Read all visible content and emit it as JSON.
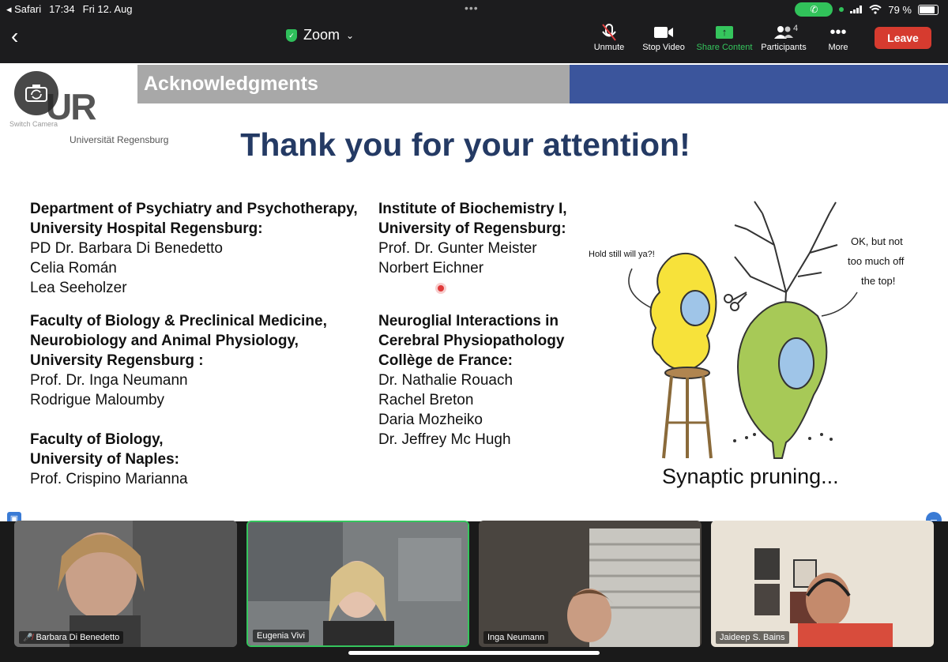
{
  "status": {
    "app": "Safari",
    "time": "17:34",
    "date": "Fri 12. Aug",
    "battery": "79 %",
    "battery_level": 0.79
  },
  "toolbar": {
    "title": "Zoom",
    "buttons": [
      {
        "label": "Unmute",
        "icon": "microphone-off-icon"
      },
      {
        "label": "Stop Video",
        "icon": "video-camera-icon"
      },
      {
        "label": "Share Content",
        "icon": "share-screen-icon"
      },
      {
        "label": "Participants",
        "icon": "participants-icon",
        "count": "4"
      },
      {
        "label": "More",
        "icon": "more-dots-icon"
      }
    ],
    "leave": "Leave",
    "accent": "#35c55d",
    "leave_color": "#d63b2f"
  },
  "slide": {
    "header": "Acknowledgments",
    "logo_letters": "UR",
    "logo_text": "Universität Regensburg",
    "switch_camera": "Switch Camera",
    "title": "Thank you for your attention!",
    "left_col": [
      {
        "heading": [
          "Department of Psychiatry and Psychotherapy,",
          "University Hospital Regensburg:"
        ],
        "names": [
          "PD Dr. Barbara Di Benedetto",
          "Celia Román",
          "Lea Seeholzer"
        ]
      },
      {
        "heading": [
          "Faculty of Biology & Preclinical Medicine,",
          "Neurobiology and Animal Physiology,",
          "University Regensburg :"
        ],
        "names": [
          "Prof. Dr. Inga Neumann",
          "Rodrigue Maloumby"
        ]
      },
      {
        "heading": [
          "Faculty of Biology,",
          "University of Naples:"
        ],
        "names": [
          "Prof. Crispino Marianna"
        ]
      }
    ],
    "right_col": [
      {
        "heading": [
          "Institute of Biochemistry I,",
          "University of Regensburg:"
        ],
        "names": [
          "Prof. Dr. Gunter Meister",
          "Norbert Eichner"
        ]
      },
      {
        "heading": [
          "Neuroglial Interactions in",
          "Cerebral Physiopathology",
          "Collège de France:"
        ],
        "names": [
          "Dr. Nathalie Rouach",
          "Rachel Breton",
          "Daria Mozheiko",
          "Dr. Jeffrey Mc Hugh"
        ]
      }
    ],
    "cartoon": {
      "bubble_left": "Hold still will ya?!",
      "bubble_right_1": "OK, but not",
      "bubble_right_2": "too much off",
      "bubble_right_3": "the top!",
      "caption": "Synaptic pruning..."
    }
  },
  "participants": [
    {
      "name": "Barbara Di Benedetto",
      "muted": true
    },
    {
      "name": "Eugenia Vivi",
      "muted": false,
      "active": true
    },
    {
      "name": "Inga Neumann",
      "muted": false
    },
    {
      "name": "Jaideep S. Bains",
      "muted": false
    }
  ]
}
